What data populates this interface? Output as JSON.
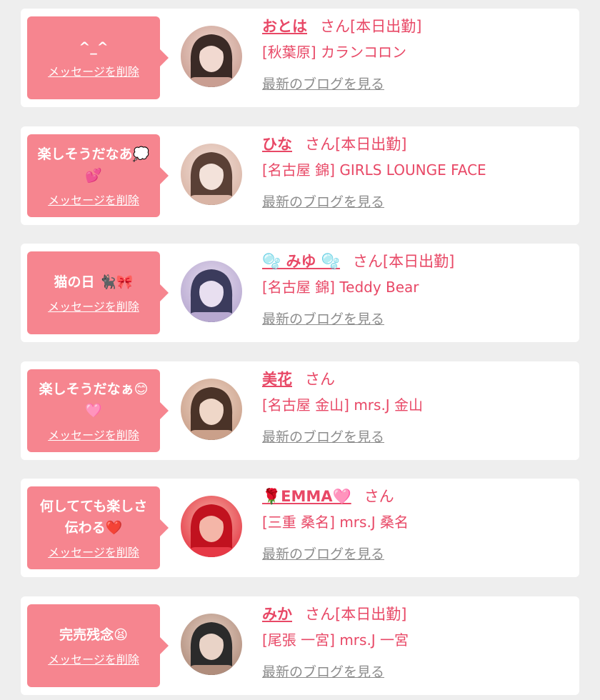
{
  "items": [
    {
      "message": "^_^",
      "delete_label": "メッセージを削除",
      "name": "おとは",
      "suffix": "さん[本日出勤]",
      "shop": "[秋葉原] カランコロン",
      "blog_label": "最新のブログを見る",
      "avatar_colors": [
        "#3a2a26",
        "#c99e92",
        "#f1d9d0"
      ]
    },
    {
      "message": "楽しそうだなあ💭\n💕",
      "delete_label": "メッセージを削除",
      "name": "ひな",
      "suffix": "さん[本日出勤]",
      "shop": "[名古屋 錦] GIRLS LOUNGE FACE",
      "blog_label": "最新のブログを見る",
      "avatar_colors": [
        "#5a4036",
        "#d9b4a5",
        "#f3e2da"
      ]
    },
    {
      "message": "猫の日 🐈‍⬛🎀",
      "delete_label": "メッセージを削除",
      "name": "🫧 みゆ 🫧",
      "suffix": "さん[本日出勤]",
      "shop": "[名古屋 錦] Teddy Bear",
      "blog_label": "最新のブログを見る",
      "avatar_colors": [
        "#3b3b5c",
        "#b7a8d0",
        "#e8dff0"
      ]
    },
    {
      "message": "楽しそうだなぁ😊\n🩷",
      "delete_label": "メッセージを削除",
      "name": "美花",
      "suffix": "さん",
      "shop": "[名古屋 金山] mrs.J 金山",
      "blog_label": "最新のブログを見る",
      "avatar_colors": [
        "#4a3328",
        "#caa08a",
        "#efd7c8"
      ]
    },
    {
      "message": "何してても楽しさ\n伝わる❤️",
      "delete_label": "メッセージを削除",
      "name": "🌹EMMA🩷",
      "suffix": "さん",
      "shop": "[三重 桑名] mrs.J 桑名",
      "blog_label": "最新のブログを見る",
      "avatar_colors": [
        "#c1121f",
        "#e63946",
        "#f4b6a8"
      ]
    },
    {
      "message": "完売残念😫",
      "delete_label": "メッセージを削除",
      "name": "みか",
      "suffix": "さん[本日出勤]",
      "shop": "[尾張 一宮] mrs.J 一宮",
      "blog_label": "最新のブログを見る",
      "avatar_colors": [
        "#2b2b2b",
        "#b08d7c",
        "#e9d3c7"
      ]
    }
  ]
}
